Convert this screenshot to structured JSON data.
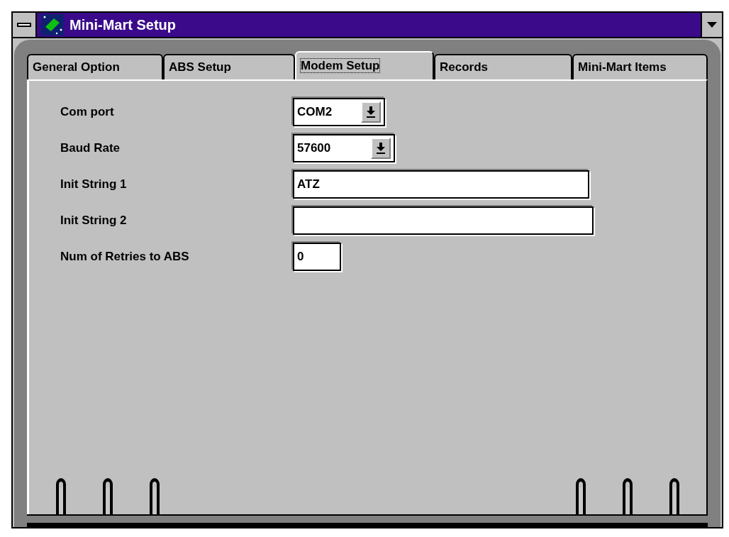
{
  "window": {
    "title": "Mini-Mart Setup"
  },
  "tabs": [
    {
      "label": "General Option",
      "selected": false
    },
    {
      "label": "ABS Setup",
      "selected": false
    },
    {
      "label": "Modem Setup",
      "selected": true
    },
    {
      "label": "Records",
      "selected": false
    },
    {
      "label": "Mini-Mart Items",
      "selected": false
    }
  ],
  "fields": [
    {
      "label": "Com port",
      "kind": "dropdown",
      "value": "COM2"
    },
    {
      "label": "Baud Rate",
      "kind": "dropdown",
      "value": "57600"
    },
    {
      "label": "Init String 1",
      "kind": "text",
      "value": "ATZ"
    },
    {
      "label": "Init String 2",
      "kind": "text"
    },
    {
      "label": "Num of Retries to ABS",
      "kind": "text",
      "value": "0"
    }
  ]
}
